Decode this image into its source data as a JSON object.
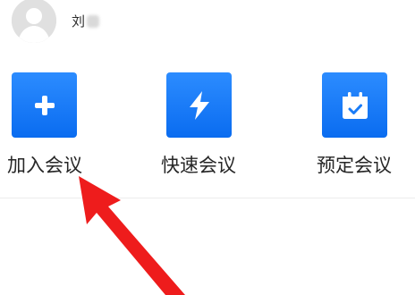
{
  "user": {
    "name": "刘"
  },
  "actions": [
    {
      "label": "加入会议",
      "icon": "plus-icon"
    },
    {
      "label": "快速会议",
      "icon": "lightning-icon"
    },
    {
      "label": "预定会议",
      "icon": "calendar-check-icon"
    }
  ],
  "colors": {
    "tile_blue": "#1a7cf7",
    "annotation_red": "#ee1c1c"
  },
  "annotation": {
    "icon": "red-arrow-icon"
  }
}
